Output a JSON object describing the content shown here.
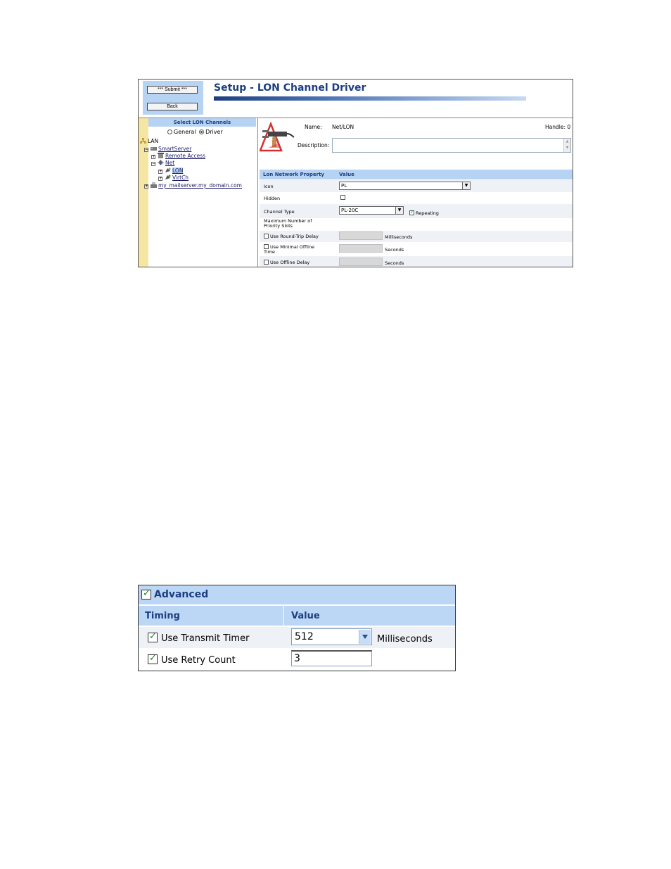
{
  "setup": {
    "buttons": {
      "submit": "*** Submit ***",
      "back": "Back"
    },
    "title": "Setup - LON Channel Driver",
    "tree": {
      "header": "Select LON Channels",
      "radio_general": "General",
      "radio_driver": "Driver",
      "selected_mode": "Driver",
      "nodes": {
        "lan": "LAN",
        "smartserver": "SmartServer",
        "remote_access": "Remote Access",
        "net": "Net",
        "lon": "LON",
        "virtch": "VirtCh",
        "mailserver": "my_mailserver.my_domain.com"
      }
    },
    "detail": {
      "name_label": "Name:",
      "name_value": "Net/LON",
      "handle_label": "Handle: 0",
      "description_label": "Description:",
      "description_value": "",
      "grid_col_property": "Lon Network Property",
      "grid_col_value": "Value",
      "icon_label": "Icon",
      "icon_value": "PL",
      "hidden_label": "Hidden",
      "hidden_checked": false,
      "channel_type_label": "Channel Type",
      "channel_type_value": "PL-20C",
      "repeating_label": "Repeating",
      "repeating_checked": true,
      "max_priority_label": "Maximum Number of Priority Slots",
      "round_trip_label": "Use Round-Trip Delay",
      "round_trip_unit": "Milliseconds",
      "min_offline_label": "Use Minimal Offline Time",
      "min_offline_unit": "Seconds",
      "offline_delay_label": "Use Offline Delay",
      "offline_delay_unit": "Seconds"
    }
  },
  "advanced": {
    "title": "Advanced",
    "checked": true,
    "col_timing": "Timing",
    "col_value": "Value",
    "transmit_label": "Use Transmit Timer",
    "transmit_checked": true,
    "transmit_value": "512",
    "transmit_unit": "Milliseconds",
    "retry_label": "Use Retry Count",
    "retry_checked": true,
    "retry_value": "3"
  },
  "icons": [
    "warning-plug-icon",
    "network-icon",
    "server-icon",
    "phone-icon",
    "net-icon",
    "lon-icon",
    "virtch-icon",
    "mail-icon"
  ]
}
